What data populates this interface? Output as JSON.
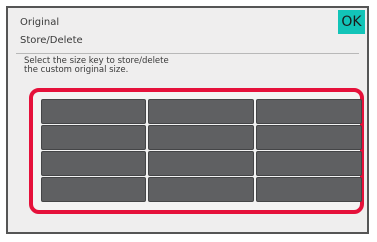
{
  "header": {
    "title_line1": "Original",
    "title_line2": "Store/Delete",
    "ok_label": "OK"
  },
  "instructions": {
    "line1": "Select the size key to store/delete",
    "line2": "the custom original size."
  },
  "size_keys": {
    "columns": 3,
    "rows": 4,
    "labels": [
      "",
      "",
      "",
      "",
      "",
      "",
      "",
      "",
      "",
      "",
      "",
      ""
    ]
  },
  "colors": {
    "ok_button": "#12c4b8",
    "highlight_frame": "#e5103a",
    "key_fill": "#5f6062",
    "panel_background": "#efeeee"
  }
}
